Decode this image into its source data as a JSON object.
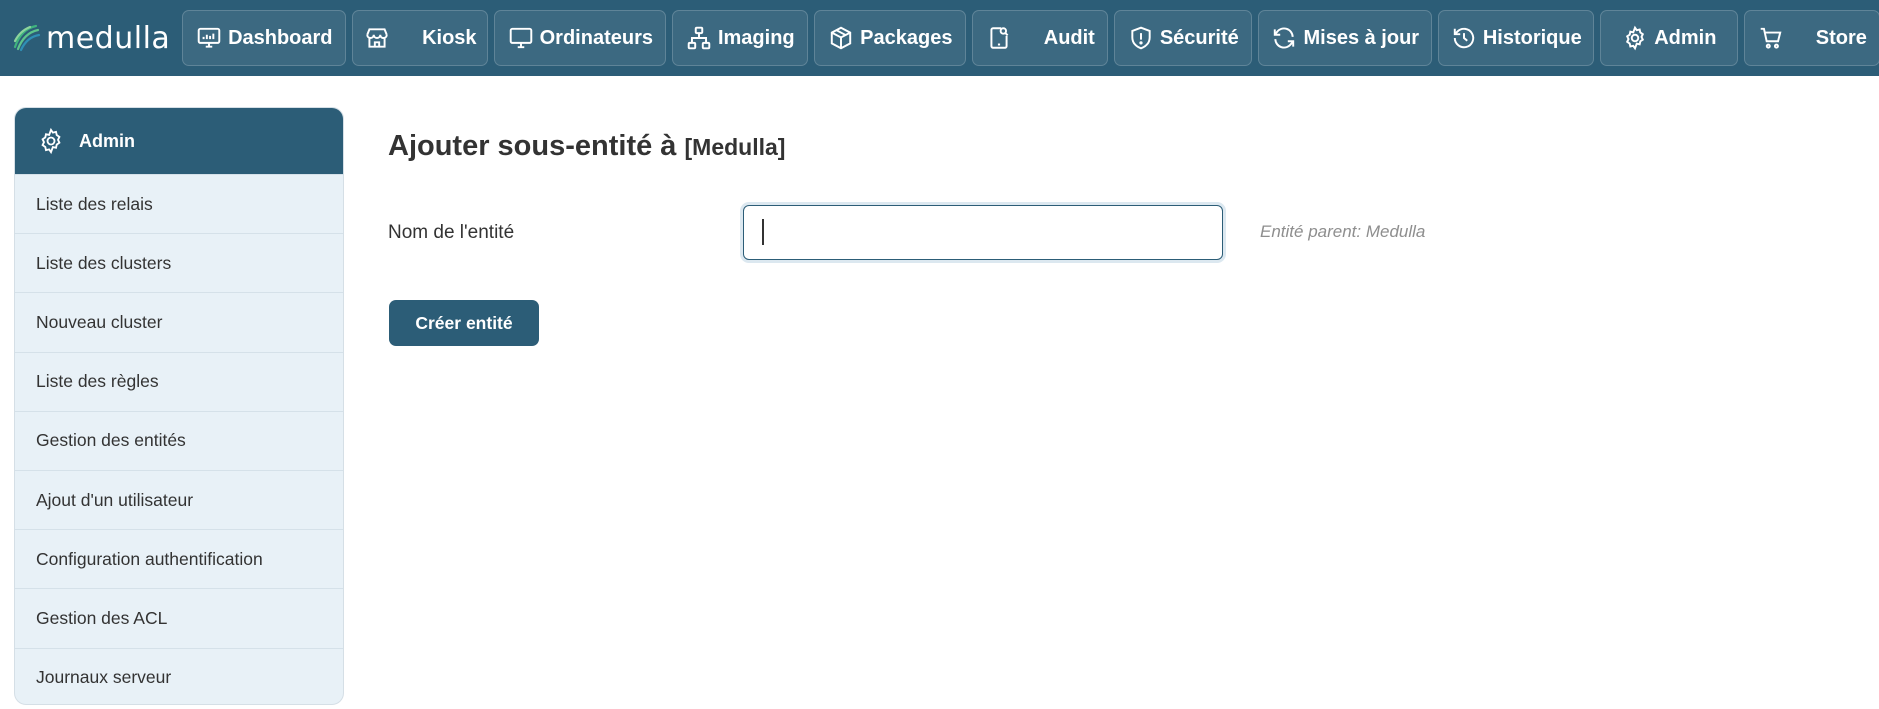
{
  "app": {
    "name": "medulla"
  },
  "nav": {
    "items": [
      {
        "label": "Dashboard",
        "icon": "dashboard-icon"
      },
      {
        "label": "Kiosk",
        "icon": "store-icon"
      },
      {
        "label": "Ordinateurs",
        "icon": "monitor-icon"
      },
      {
        "label": "Imaging",
        "icon": "network-icon"
      },
      {
        "label": "Packages",
        "icon": "package-icon"
      },
      {
        "label": "Audit",
        "icon": "audit-icon"
      },
      {
        "label": "Sécurité",
        "icon": "shield-icon"
      },
      {
        "label": "Mises à jour",
        "icon": "refresh-icon"
      },
      {
        "label": "Historique",
        "icon": "history-icon"
      },
      {
        "label": "Admin",
        "icon": "gear-icon"
      },
      {
        "label": "Store",
        "icon": "cart-icon"
      }
    ]
  },
  "sidebar": {
    "title": "Admin",
    "items": [
      {
        "label": "Liste des relais"
      },
      {
        "label": "Liste des clusters"
      },
      {
        "label": "Nouveau cluster"
      },
      {
        "label": "Liste des règles"
      },
      {
        "label": "Gestion des entités"
      },
      {
        "label": "Ajout d'un utilisateur"
      },
      {
        "label": "Configuration authentification"
      },
      {
        "label": "Gestion des ACL"
      },
      {
        "label": "Journaux serveur"
      }
    ]
  },
  "main": {
    "title": "Ajouter sous-entité à",
    "entity": "[Medulla]",
    "form": {
      "name_label": "Nom de l'entité",
      "name_value": "",
      "hint": "Entité parent: Medulla",
      "submit_label": "Créer entité"
    }
  },
  "colors": {
    "brand": "#2c5d77",
    "sidebar_bg": "#e8f1f7",
    "hint": "#8e8e8e"
  }
}
